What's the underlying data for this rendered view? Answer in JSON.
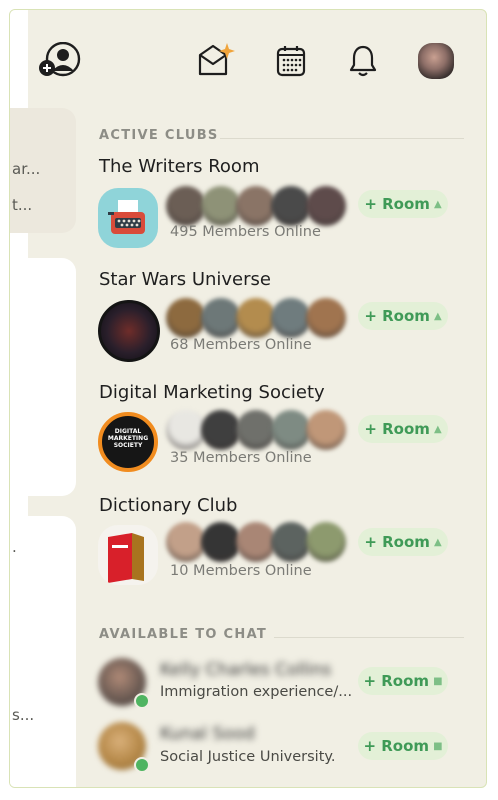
{
  "header": {
    "icons": [
      "add-person-icon",
      "new-envelope-icon",
      "calendar-icon",
      "bell-icon",
      "profile-avatar"
    ]
  },
  "side_cards": {
    "card1_lines": [
      "ar...",
      "t..."
    ],
    "card3_lines": [
      ".",
      "s..."
    ]
  },
  "active_clubs": {
    "title": "ACTIVE CLUBS",
    "clubs": [
      {
        "name": "The Writers Room",
        "online": "495 Members Online",
        "room_label": "+ Room",
        "member_colors": [
          "#6b5e55",
          "#8e9277",
          "#8a7466",
          "#4a4a4a",
          "#5e4b4b"
        ]
      },
      {
        "name": "Star Wars Universe",
        "online": "68 Members Online",
        "room_label": "+ Room",
        "member_colors": [
          "#8d6a3f",
          "#6d7878",
          "#b38c4e",
          "#6f7c7e",
          "#a0744f"
        ]
      },
      {
        "name": "Digital Marketing Society",
        "online": "35 Members Online",
        "room_label": "+ Room",
        "member_colors": [
          "#e8e7e2",
          "#3f3f3f",
          "#6f706b",
          "#7e8b83",
          "#c09778"
        ]
      },
      {
        "name": "Dictionary Club",
        "online": "10 Members Online",
        "room_label": "+ Room",
        "member_colors": [
          "#c2a089",
          "#353535",
          "#a98675",
          "#5c6360",
          "#8d9a6e"
        ]
      }
    ]
  },
  "available": {
    "title": "AVAILABLE TO CHAT",
    "people": [
      {
        "name": "Kelly Charles Collins",
        "subtitle": "Immigration experience/...",
        "room_label": "+ Room"
      },
      {
        "name": "Kunal Sood",
        "subtitle": "Social Justice University.",
        "room_label": "+ Room"
      }
    ]
  },
  "colors": {
    "background": "#f1efe4",
    "room_button_bg": "#e3f0d7",
    "room_button_text": "#3f9a57",
    "online_dot": "#4fb461"
  }
}
